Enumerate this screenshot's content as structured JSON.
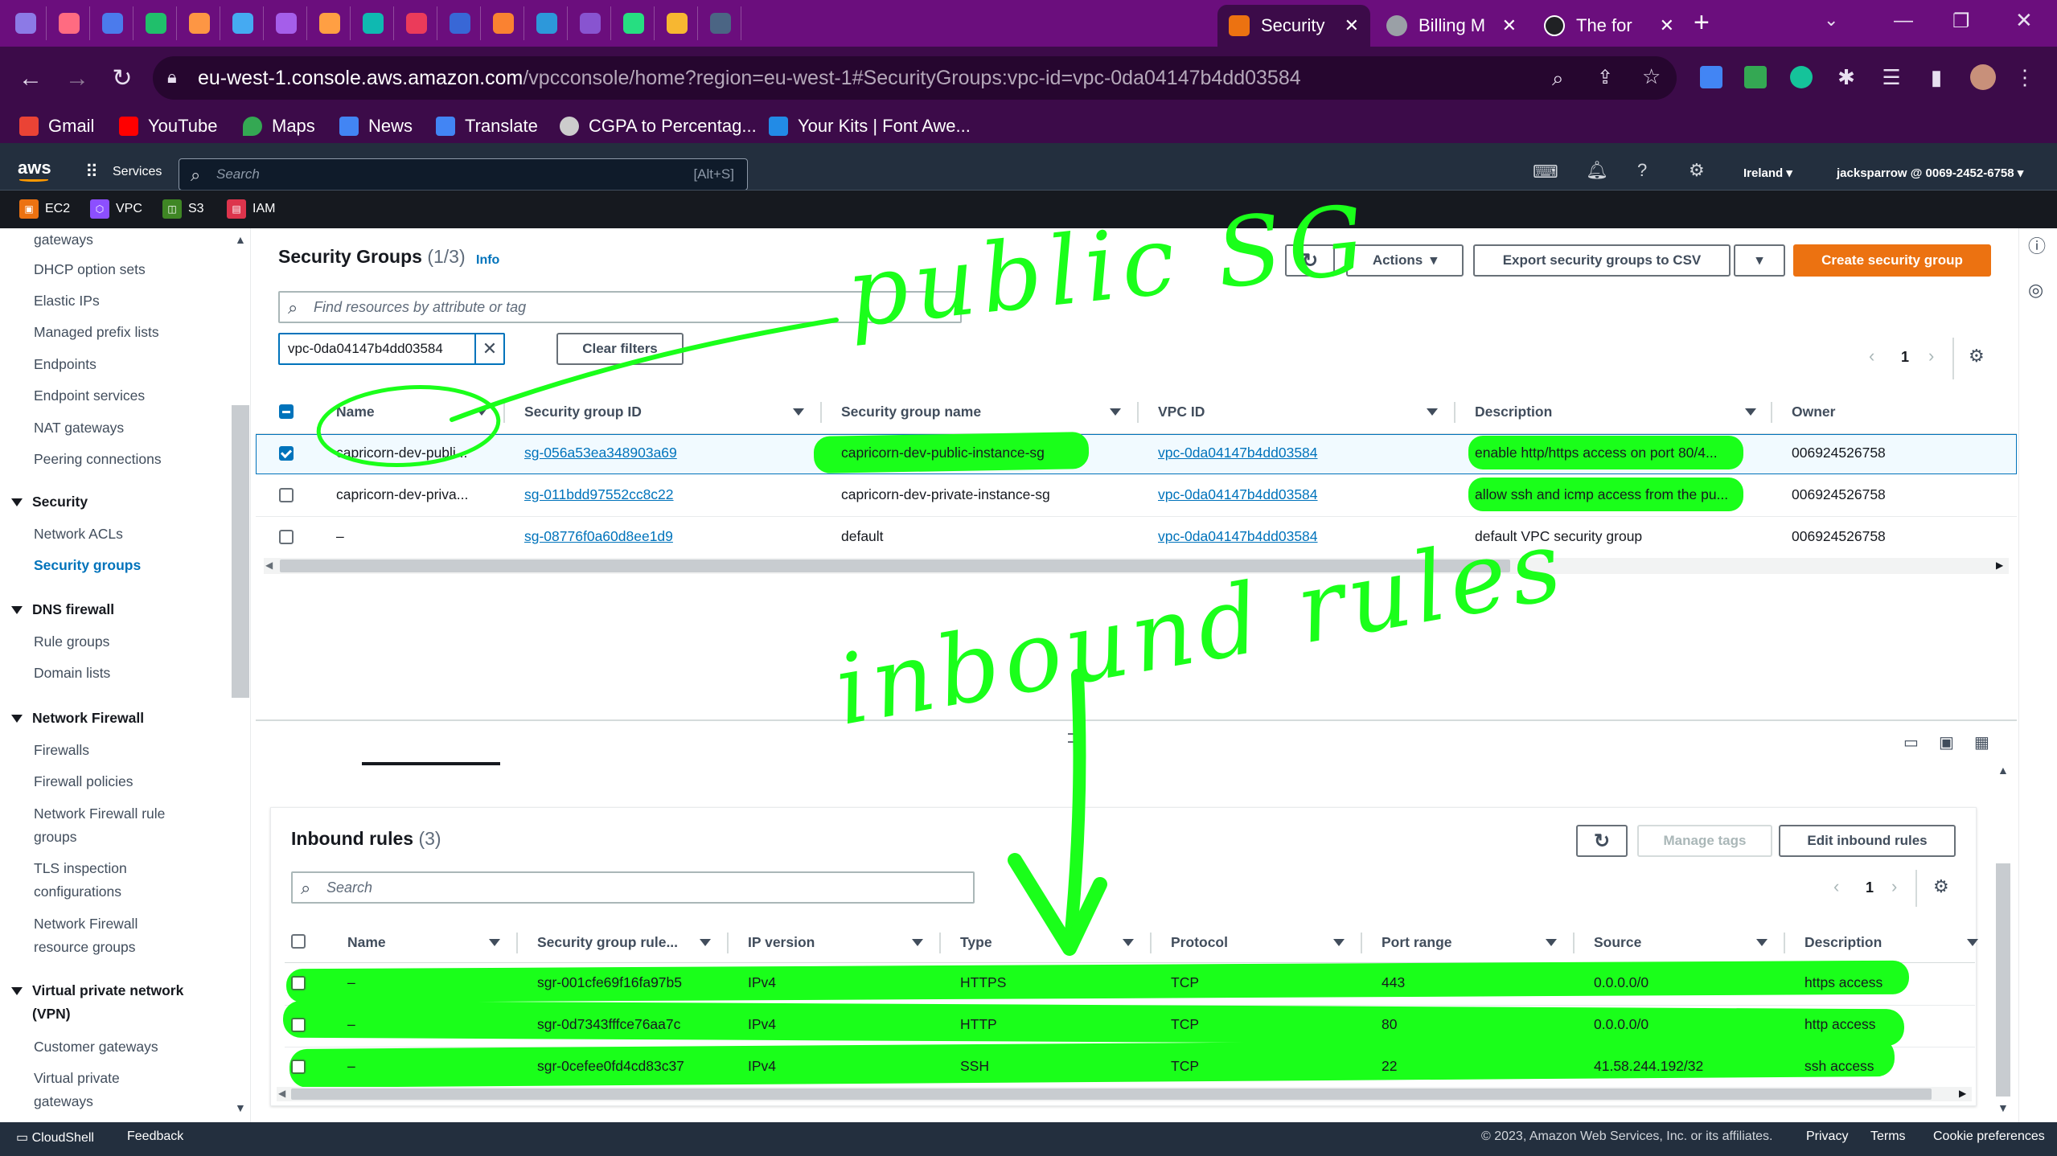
{
  "browser": {
    "tabs": [
      {
        "label": "Security",
        "active": true,
        "favicon_color": "#ec7211"
      },
      {
        "label": "Billing M",
        "active": false,
        "favicon_color": "#9aa0a6"
      },
      {
        "label": "The for",
        "active": false,
        "favicon_color": "#202124"
      }
    ],
    "url_host": "eu-west-1.console.aws.amazon.com",
    "url_path": "/vpcconsole/home?region=eu-west-1#SecurityGroups:vpc-id=vpc-0da04147b4dd03584",
    "bookmarks": [
      {
        "label": "Gmail",
        "color": "#ea4335"
      },
      {
        "label": "YouTube",
        "color": "#ff0000"
      },
      {
        "label": "Maps",
        "color": "#34a853"
      },
      {
        "label": "News",
        "color": "#4285f4"
      },
      {
        "label": "Translate",
        "color": "#4285f4"
      },
      {
        "label": "CGPA to Percentag...",
        "color": "#cccccc"
      },
      {
        "label": "Your Kits | Font Awe...",
        "color": "#228be6"
      }
    ]
  },
  "aws_header": {
    "logo": "aws",
    "services_label": "Services",
    "search_placeholder": "Search",
    "search_shortcut": "[Alt+S]",
    "region": "Ireland",
    "account": "jacksparrow @ 0069-2452-6758",
    "favorites": [
      {
        "label": "EC2",
        "color": "#ec7211"
      },
      {
        "label": "VPC",
        "color": "#8c4fff"
      },
      {
        "label": "S3",
        "color": "#3f8624"
      },
      {
        "label": "IAM",
        "color": "#dd344c"
      }
    ]
  },
  "sidebar": {
    "items_top": [
      "gateways",
      "DHCP option sets",
      "Elastic IPs",
      "Managed prefix lists",
      "Endpoints",
      "Endpoint services",
      "NAT gateways",
      "Peering connections"
    ],
    "security_header": "Security",
    "security_items": [
      "Network ACLs",
      "Security groups"
    ],
    "dns_header": "DNS firewall",
    "dns_items": [
      "Rule groups",
      "Domain lists"
    ],
    "nf_header": "Network Firewall",
    "nf_items": [
      "Firewalls",
      "Firewall policies",
      "Network Firewall rule groups",
      "TLS inspection configurations",
      "Network Firewall resource groups"
    ],
    "vpn_header": "Virtual private network (VPN)",
    "vpn_items": [
      "Customer gateways",
      "Virtual private gateways"
    ]
  },
  "sg_panel": {
    "title": "Security Groups",
    "count": "(1/3)",
    "info": "Info",
    "actions_label": "Actions",
    "export_label": "Export security groups to CSV",
    "create_label": "Create security group",
    "search_placeholder": "Find resources by attribute or tag",
    "filter_token": "vpc-0da04147b4dd03584",
    "clear_filters": "Clear filters",
    "page": "1",
    "columns": [
      "Name",
      "Security group ID",
      "Security group name",
      "VPC ID",
      "Description",
      "Owner"
    ],
    "rows": [
      {
        "selected": true,
        "name": "capricorn-dev-publi...",
        "id": "sg-056a53ea348903a69",
        "group_name": "capricorn-dev-public-instance-sg",
        "vpc": "vpc-0da04147b4dd03584",
        "description": "enable http/https access on port 80/4...",
        "owner": "006924526758"
      },
      {
        "selected": false,
        "name": "capricorn-dev-priva...",
        "id": "sg-011bdd97552cc8c22",
        "group_name": "capricorn-dev-private-instance-sg",
        "vpc": "vpc-0da04147b4dd03584",
        "description": "allow ssh and icmp access from the pu...",
        "owner": "006924526758"
      },
      {
        "selected": false,
        "name": "–",
        "id": "sg-08776f0a60d8ee1d9",
        "group_name": "default",
        "vpc": "vpc-0da04147b4dd03584",
        "description": "default VPC security group",
        "owner": "006924526758"
      }
    ]
  },
  "inbound_panel": {
    "title": "Inbound rules",
    "count": "(3)",
    "manage_tags": "Manage tags",
    "edit_label": "Edit inbound rules",
    "search_placeholder": "Search",
    "page": "1",
    "columns": [
      "Name",
      "Security group rule...",
      "IP version",
      "Type",
      "Protocol",
      "Port range",
      "Source",
      "Description"
    ],
    "rows": [
      {
        "name": "–",
        "rule_id": "sgr-001cfe69f16fa97b5",
        "ip": "IPv4",
        "type": "HTTPS",
        "protocol": "TCP",
        "port": "443",
        "source": "0.0.0.0/0",
        "description": "https access"
      },
      {
        "name": "–",
        "rule_id": "sgr-0d7343fffce76aa7c",
        "ip": "IPv4",
        "type": "HTTP",
        "protocol": "TCP",
        "port": "80",
        "source": "0.0.0.0/0",
        "description": "http access"
      },
      {
        "name": "–",
        "rule_id": "sgr-0cefee0fd4cd83c37",
        "ip": "IPv4",
        "type": "SSH",
        "protocol": "TCP",
        "port": "22",
        "source": "41.58.244.192/32",
        "description": "ssh access"
      }
    ]
  },
  "annotations": {
    "public_sg": "public SG",
    "inbound_rules": "inbound rules",
    "color": "#1aff1a"
  },
  "footer": {
    "cloudshell": "CloudShell",
    "feedback": "Feedback",
    "copyright": "© 2023, Amazon Web Services, Inc. or its affiliates.",
    "privacy": "Privacy",
    "terms": "Terms",
    "cookies": "Cookie preferences"
  }
}
